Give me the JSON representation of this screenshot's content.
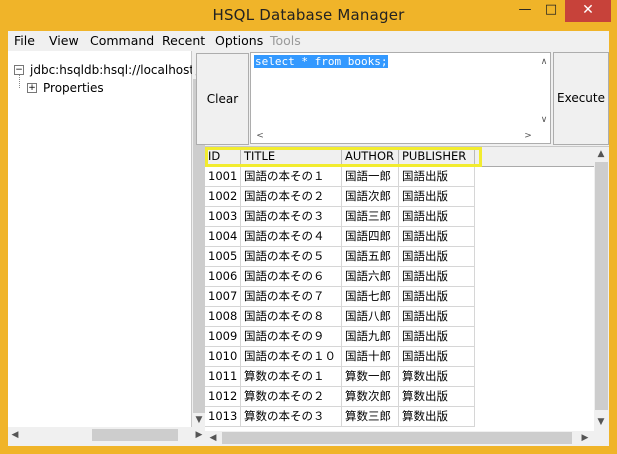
{
  "window": {
    "title": "HSQL Database Manager"
  },
  "menu": [
    "File",
    "View",
    "Command",
    "Recent",
    "Options",
    "Tools"
  ],
  "tree": {
    "connection": "jdbc:hsqldb:hsql://localhost/",
    "properties": "Properties"
  },
  "buttons": {
    "clear": "Clear",
    "execute": "Execute"
  },
  "query": {
    "text": "select * from books;"
  },
  "grid": {
    "columns": [
      "ID",
      "TITLE",
      "AUTHOR",
      "PUBLISHER"
    ],
    "rows": [
      [
        "1001",
        "国語の本その１",
        "国語一郎",
        "国語出版"
      ],
      [
        "1002",
        "国語の本その２",
        "国語次郎",
        "国語出版"
      ],
      [
        "1003",
        "国語の本その３",
        "国語三郎",
        "国語出版"
      ],
      [
        "1004",
        "国語の本その４",
        "国語四郎",
        "国語出版"
      ],
      [
        "1005",
        "国語の本その５",
        "国語五郎",
        "国語出版"
      ],
      [
        "1006",
        "国語の本その６",
        "国語六郎",
        "国語出版"
      ],
      [
        "1007",
        "国語の本その７",
        "国語七郎",
        "国語出版"
      ],
      [
        "1008",
        "国語の本その８",
        "国語八郎",
        "国語出版"
      ],
      [
        "1009",
        "国語の本その９",
        "国語九郎",
        "国語出版"
      ],
      [
        "1010",
        "国語の本その１０",
        "国語十郎",
        "国語出版"
      ],
      [
        "1011",
        "算数の本その１",
        "算数一郎",
        "算数出版"
      ],
      [
        "1012",
        "算数の本その２",
        "算数次郎",
        "算数出版"
      ],
      [
        "1013",
        "算数の本その３",
        "算数三郎",
        "算数出版"
      ]
    ]
  },
  "colors": {
    "titlebar": "#f0b429",
    "close": "#c7423a",
    "selection": "#3399ff",
    "highlight": "#f2ec2f"
  }
}
